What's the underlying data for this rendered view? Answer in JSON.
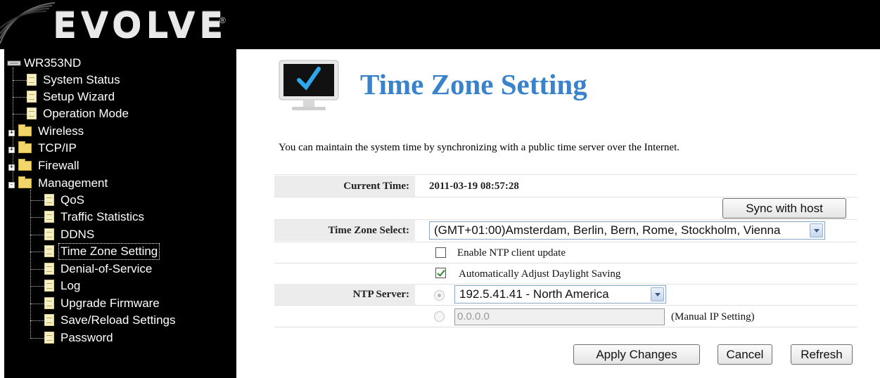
{
  "header": {
    "logo_text": "EVOLVE",
    "logo_mark": "®"
  },
  "sidebar": {
    "root": "WR353ND",
    "items": [
      {
        "label": "System Status",
        "type": "doc"
      },
      {
        "label": "Setup Wizard",
        "type": "doc"
      },
      {
        "label": "Operation Mode",
        "type": "doc"
      },
      {
        "label": "Wireless",
        "type": "folder",
        "expander": "+"
      },
      {
        "label": "TCP/IP",
        "type": "folder",
        "expander": "+"
      },
      {
        "label": "Firewall",
        "type": "folder",
        "expander": "+"
      },
      {
        "label": "Management",
        "type": "folder-open",
        "expander": "-"
      }
    ],
    "sub_items": [
      {
        "label": "QoS"
      },
      {
        "label": "Traffic Statistics"
      },
      {
        "label": "DDNS"
      },
      {
        "label": "Time Zone Setting",
        "active": true
      },
      {
        "label": "Denial-of-Service"
      },
      {
        "label": "Log"
      },
      {
        "label": "Upgrade Firmware"
      },
      {
        "label": "Save/Reload Settings"
      },
      {
        "label": "Password"
      }
    ]
  },
  "main": {
    "title": "Time Zone Setting",
    "title_icon": "monitor-checkmark-icon",
    "description": "You can maintain the system time by synchronizing with a public time server over the Internet.",
    "current_time_label": "Current Time:",
    "current_time_value": "2011-03-19 08:57:28",
    "sync_button": "Sync with host",
    "time_zone_label": "Time Zone Select:",
    "time_zone_value": "(GMT+01:00)Amsterdam, Berlin, Bern, Rome, Stockholm, Vienna",
    "ntp_enable_label": "Enable NTP client update",
    "ntp_enable_checked": false,
    "daylight_label": "Automatically Adjust Daylight Saving",
    "daylight_checked": true,
    "ntp_server_label": "NTP Server:",
    "ntp_server_value": "192.5.41.41 - North America",
    "manual_ip_value": "0.0.0.0",
    "manual_ip_note": "(Manual IP Setting)",
    "buttons": {
      "apply": "Apply Changes",
      "cancel": "Cancel",
      "refresh": "Refresh"
    }
  },
  "colors": {
    "title": "#3a83cb",
    "sidebar_bg": "#000000",
    "label_bg": "#ececec"
  }
}
